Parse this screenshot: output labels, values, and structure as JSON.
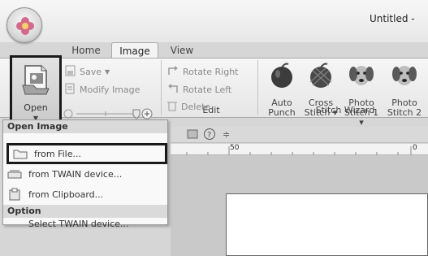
{
  "window": {
    "title": "Untitled -"
  },
  "tabs": [
    {
      "label": "Home"
    },
    {
      "label": "Image"
    },
    {
      "label": "View"
    }
  ],
  "ribbon": {
    "open": {
      "label": "Open"
    },
    "save": {
      "label": "Save"
    },
    "modify_image": {
      "label": "Modify Image"
    },
    "rotate_right": {
      "label": "Rotate Right"
    },
    "rotate_left": {
      "label": "Rotate Left"
    },
    "delete": {
      "label": "Delete"
    },
    "edit_group_label": "Edit",
    "stitch_wizard_label": "Stitch Wizard",
    "wizard_items": [
      {
        "line1": "Auto",
        "line2": "Punch"
      },
      {
        "line1": "Cross",
        "line2": "Stitch ▾"
      },
      {
        "line1": "Photo",
        "line2": "Stitch 1 ▾"
      },
      {
        "line1": "Photo",
        "line2": "Stitch 2"
      }
    ]
  },
  "dropdown": {
    "header_open_image": "Open Image",
    "items": [
      {
        "label": "from File..."
      },
      {
        "label": "from TWAIN device..."
      },
      {
        "label": "from Clipboard..."
      }
    ],
    "header_option": "Option",
    "option_items": [
      {
        "label": "Select TWAIN device..."
      }
    ]
  },
  "ruler": {
    "mark_50": "50",
    "mark_0": "0"
  },
  "colors": {
    "highlight_border": "#1a1a1a",
    "ribbon_bg": "#eeeeee"
  }
}
